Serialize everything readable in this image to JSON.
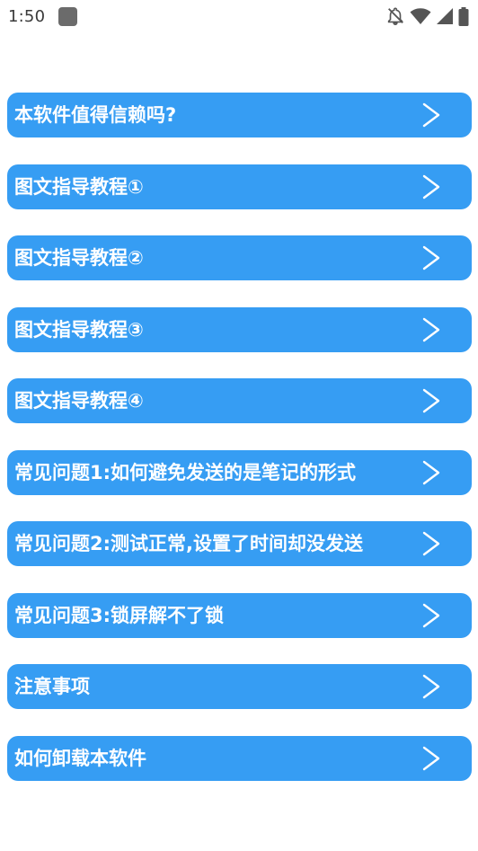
{
  "status_bar": {
    "time": "1:50",
    "icons": [
      "app-notification-icon",
      "notifications-off-icon",
      "wifi-icon",
      "cellular-signal-icon",
      "battery-icon"
    ]
  },
  "colors": {
    "item_background": "#369df3",
    "item_text": "#ffffff",
    "page_background": "#ffffff"
  },
  "menu": {
    "items": [
      {
        "label": "本软件值得信赖吗?",
        "icon": "chevron-right-icon"
      },
      {
        "label": "图文指导教程①",
        "icon": "chevron-right-icon"
      },
      {
        "label": "图文指导教程②",
        "icon": "chevron-right-icon"
      },
      {
        "label": "图文指导教程③",
        "icon": "chevron-right-icon"
      },
      {
        "label": "图文指导教程④",
        "icon": "chevron-right-icon"
      },
      {
        "label": "常见问题1:如何避免发送的是笔记的形式",
        "icon": "chevron-right-icon"
      },
      {
        "label": "常见问题2:测试正常,设置了时间却没发送",
        "icon": "chevron-right-icon"
      },
      {
        "label": "常见问题3:锁屏解不了锁",
        "icon": "chevron-right-icon"
      },
      {
        "label": "注意事项",
        "icon": "chevron-right-icon"
      },
      {
        "label": "如何卸载本软件",
        "icon": "chevron-right-icon"
      }
    ]
  }
}
